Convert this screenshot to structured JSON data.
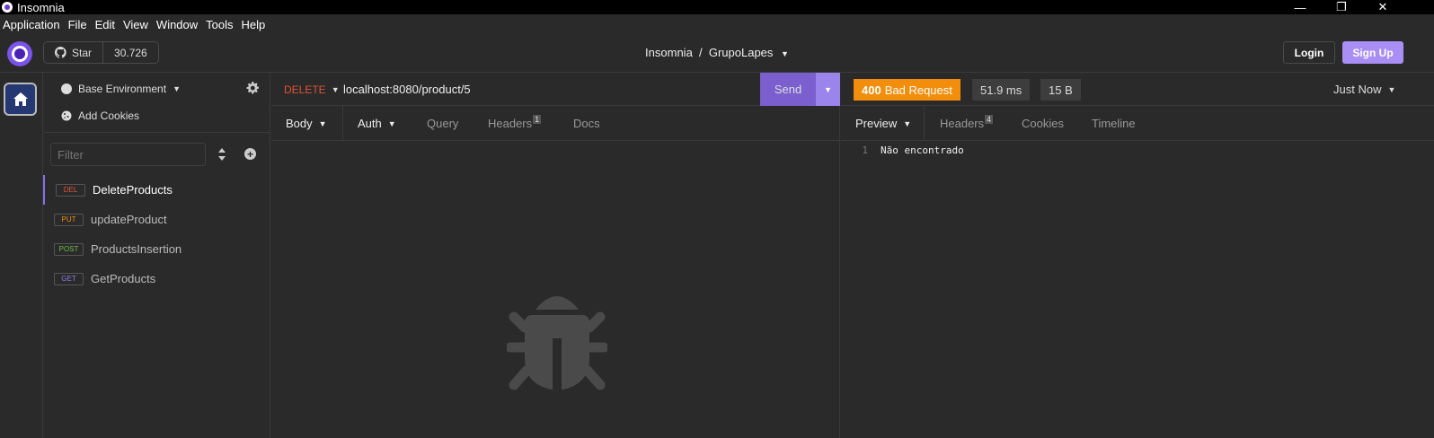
{
  "window": {
    "title": "Insomnia",
    "minimize": "—",
    "maximize": "❐",
    "close": "✕"
  },
  "menubar": {
    "items": [
      "Application",
      "File",
      "Edit",
      "View",
      "Window",
      "Tools",
      "Help"
    ]
  },
  "header": {
    "star_label": "Star",
    "star_count": "30.726",
    "breadcrumb": "Insomnia  /  GrupoLapes",
    "login": "Login",
    "signup": "Sign Up"
  },
  "sidebar": {
    "environment": "Base Environment",
    "add_cookies": "Add Cookies",
    "filter_placeholder": "Filter",
    "requests": [
      {
        "method": "DEL",
        "name": "DeleteProducts",
        "color": "#e0543a",
        "active": true
      },
      {
        "method": "PUT",
        "name": "updateProduct",
        "color": "#f28e0b",
        "active": false
      },
      {
        "method": "POST",
        "name": "ProductsInsertion",
        "color": "#6cc24a",
        "active": false
      },
      {
        "method": "GET",
        "name": "GetProducts",
        "color": "#8e7de8",
        "active": false
      }
    ]
  },
  "request": {
    "method": "DELETE",
    "url": "localhost:8080/product/5",
    "send": "Send",
    "tabs": {
      "body": "Body",
      "auth": "Auth",
      "query": "Query",
      "headers": "Headers",
      "headers_count": "1",
      "docs": "Docs"
    }
  },
  "response": {
    "status_code": "400",
    "status_text": "Bad Request",
    "time": "51.9 ms",
    "size": "15 B",
    "time_ago": "Just Now",
    "tabs": {
      "preview": "Preview",
      "headers": "Headers",
      "headers_count": "4",
      "cookies": "Cookies",
      "timeline": "Timeline"
    },
    "body": {
      "line": "1",
      "text": "Não encontrado"
    }
  },
  "colors": {
    "accent": "#7b5fcf",
    "status_bg": "#f28e0b",
    "delete": "#e0543a"
  }
}
